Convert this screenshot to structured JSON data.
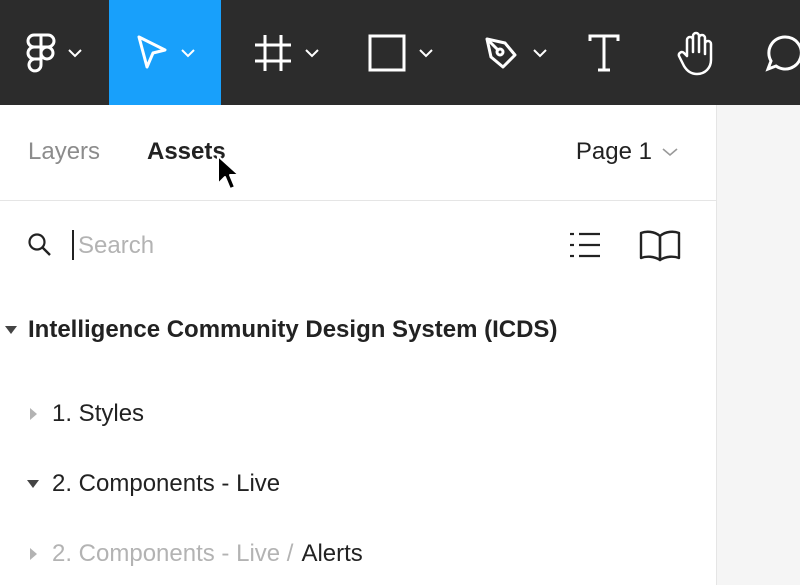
{
  "toolbar": {
    "tools": [
      {
        "icon": "figma-logo-icon",
        "has_menu": true,
        "active": false
      },
      {
        "icon": "move-tool-icon",
        "has_menu": true,
        "active": true
      },
      {
        "icon": "frame-tool-icon",
        "has_menu": true,
        "active": false
      },
      {
        "icon": "rectangle-tool-icon",
        "has_menu": true,
        "active": false
      },
      {
        "icon": "pen-tool-icon",
        "has_menu": true,
        "active": false
      },
      {
        "icon": "text-tool-icon",
        "has_menu": false,
        "active": false
      },
      {
        "icon": "hand-tool-icon",
        "has_menu": false,
        "active": false
      },
      {
        "icon": "comment-tool-icon",
        "has_menu": false,
        "active": false
      }
    ],
    "colors": {
      "background": "#2c2c2c",
      "active": "#18a0fb"
    }
  },
  "panel": {
    "tabs": {
      "layers": "Layers",
      "assets": "Assets"
    },
    "active_tab": "Assets",
    "page_selector": "Page 1"
  },
  "search": {
    "placeholder": "Search",
    "value": ""
  },
  "library": {
    "title": "Intelligence Community Design System (ICDS)",
    "items": [
      {
        "label": "1. Styles",
        "expanded": false
      },
      {
        "label": "2. Components - Live",
        "expanded": true
      }
    ],
    "breadcrumb_row": {
      "parent": "2. Components - Live /",
      "current": "Alerts"
    }
  }
}
